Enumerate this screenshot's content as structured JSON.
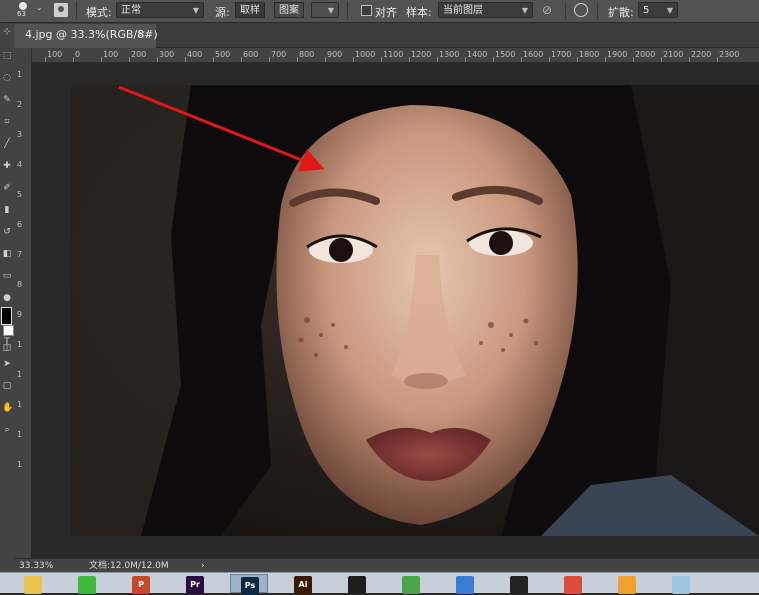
{
  "options_bar": {
    "brush_size": "63",
    "mode_label": "模式:",
    "mode_value": "正常",
    "source_label": "源:",
    "source_sampled": "取样",
    "source_pattern": "图案",
    "align_label": "对齐",
    "sample_label": "样本:",
    "sample_value": "当前图层",
    "diffusion_label": "扩散:",
    "diffusion_value": "5"
  },
  "document": {
    "tab_title": "4.jpg @ 33.3%(RGB/8#)",
    "close_glyph": "×"
  },
  "ruler": {
    "top_ticks": [
      "100",
      "0",
      "100",
      "200",
      "300",
      "400",
      "500",
      "600",
      "700",
      "800",
      "900",
      "1000",
      "1100",
      "1200",
      "1300",
      "1400",
      "1500",
      "1600",
      "1700",
      "1800",
      "1900",
      "2000",
      "2100",
      "2200",
      "2300"
    ],
    "left_ticks": [
      "1",
      "2",
      "3",
      "4",
      "5",
      "6",
      "7",
      "8",
      "9",
      "1",
      "1",
      "1",
      "1",
      "1"
    ]
  },
  "status_bar": {
    "zoom": "33.33%",
    "doc_info": "文档:12.0M/12.0M",
    "arrow": "›"
  },
  "taskbar": {
    "apps": [
      {
        "name": "file-explorer",
        "label": "",
        "color": "#e8c24a"
      },
      {
        "name": "wechat",
        "label": "",
        "color": "#3fb83f"
      },
      {
        "name": "powerpoint",
        "label": "P",
        "color": "#c8462a"
      },
      {
        "name": "premiere",
        "label": "Pr",
        "color": "#2b0a40"
      },
      {
        "name": "photoshop",
        "label": "Ps",
        "color": "#0b2a44"
      },
      {
        "name": "illustrator",
        "label": "Ai",
        "color": "#3a1a00"
      },
      {
        "name": "media-encoder",
        "label": "",
        "color": "#1e1e1e"
      },
      {
        "name": "app-green-red",
        "label": "",
        "color": "#4aa54a"
      },
      {
        "name": "app-blue",
        "label": "",
        "color": "#3a7bd5"
      },
      {
        "name": "qq",
        "label": "",
        "color": "#222222"
      },
      {
        "name": "chrome",
        "label": "",
        "color": "#dd4b39"
      },
      {
        "name": "app-orange",
        "label": "",
        "color": "#f0a030"
      },
      {
        "name": "app-light",
        "label": "",
        "color": "#9bc4e0"
      }
    ]
  },
  "colors": {
    "panel": "#535353",
    "workspace": "#282828",
    "accent_arrow": "#e01818"
  }
}
